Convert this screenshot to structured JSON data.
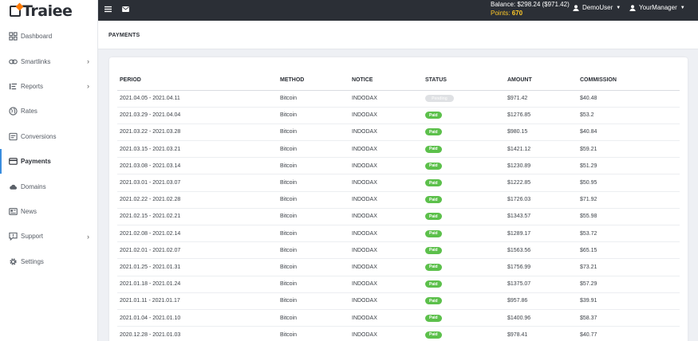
{
  "app": {
    "logo_text": "Traiee"
  },
  "sidebar": {
    "items": [
      {
        "label": "Dashboard",
        "icon": "dashboard-icon",
        "chevron": false,
        "active": false
      },
      {
        "label": "Smartlinks",
        "icon": "link-icon",
        "chevron": true,
        "active": false
      },
      {
        "label": "Reports",
        "icon": "reports-icon",
        "chevron": true,
        "active": false
      },
      {
        "label": "Rates",
        "icon": "globe-icon",
        "chevron": false,
        "active": false
      },
      {
        "label": "Conversions",
        "icon": "conversions-icon",
        "chevron": false,
        "active": false
      },
      {
        "label": "Payments",
        "icon": "credit-card-icon",
        "chevron": false,
        "active": true
      },
      {
        "label": "Domains",
        "icon": "cloud-icon",
        "chevron": false,
        "active": false
      },
      {
        "label": "News",
        "icon": "newspaper-icon",
        "chevron": false,
        "active": false
      },
      {
        "label": "Support",
        "icon": "support-icon",
        "chevron": true,
        "active": false
      },
      {
        "label": "Settings",
        "icon": "gear-icon",
        "chevron": false,
        "active": false
      }
    ]
  },
  "topbar": {
    "balance_label": "Balance: $298.24 ($971.42)",
    "points_label": "Points:",
    "points_value": "670",
    "user_label": "DemoUser",
    "manager_label": "YourManager"
  },
  "page": {
    "title": "PAYMENTS"
  },
  "table": {
    "headers": [
      "PERIOD",
      "METHOD",
      "NOTICE",
      "STATUS",
      "AMOUNT",
      "COMMISSION"
    ],
    "rows": [
      {
        "period": "2021.04.05 - 2021.04.11",
        "method": "Bitcoin",
        "notice": "INDODAX",
        "status": "Pending",
        "amount": "$971.42",
        "commission": "$40.48"
      },
      {
        "period": "2021.03.29 - 2021.04.04",
        "method": "Bitcoin",
        "notice": "INDODAX",
        "status": "Paid",
        "amount": "$1276.85",
        "commission": "$53.2"
      },
      {
        "period": "2021.03.22 - 2021.03.28",
        "method": "Bitcoin",
        "notice": "INDODAX",
        "status": "Paid",
        "amount": "$980.15",
        "commission": "$40.84"
      },
      {
        "period": "2021.03.15 - 2021.03.21",
        "method": "Bitcoin",
        "notice": "INDODAX",
        "status": "Paid",
        "amount": "$1421.12",
        "commission": "$59.21"
      },
      {
        "period": "2021.03.08 - 2021.03.14",
        "method": "Bitcoin",
        "notice": "INDODAX",
        "status": "Paid",
        "amount": "$1230.89",
        "commission": "$51.29"
      },
      {
        "period": "2021.03.01 - 2021.03.07",
        "method": "Bitcoin",
        "notice": "INDODAX",
        "status": "Paid",
        "amount": "$1222.85",
        "commission": "$50.95"
      },
      {
        "period": "2021.02.22 - 2021.02.28",
        "method": "Bitcoin",
        "notice": "INDODAX",
        "status": "Paid",
        "amount": "$1726.03",
        "commission": "$71.92"
      },
      {
        "period": "2021.02.15 - 2021.02.21",
        "method": "Bitcoin",
        "notice": "INDODAX",
        "status": "Paid",
        "amount": "$1343.57",
        "commission": "$55.98"
      },
      {
        "period": "2021.02.08 - 2021.02.14",
        "method": "Bitcoin",
        "notice": "INDODAX",
        "status": "Paid",
        "amount": "$1289.17",
        "commission": "$53.72"
      },
      {
        "period": "2021.02.01 - 2021.02.07",
        "method": "Bitcoin",
        "notice": "INDODAX",
        "status": "Paid",
        "amount": "$1563.56",
        "commission": "$65.15"
      },
      {
        "period": "2021.01.25 - 2021.01.31",
        "method": "Bitcoin",
        "notice": "INDODAX",
        "status": "Paid",
        "amount": "$1756.99",
        "commission": "$73.21"
      },
      {
        "period": "2021.01.18 - 2021.01.24",
        "method": "Bitcoin",
        "notice": "INDODAX",
        "status": "Paid",
        "amount": "$1375.07",
        "commission": "$57.29"
      },
      {
        "period": "2021.01.11 - 2021.01.17",
        "method": "Bitcoin",
        "notice": "INDODAX",
        "status": "Paid",
        "amount": "$957.86",
        "commission": "$39.91"
      },
      {
        "period": "2021.01.04 - 2021.01.10",
        "method": "Bitcoin",
        "notice": "INDODAX",
        "status": "Paid",
        "amount": "$1400.96",
        "commission": "$58.37"
      },
      {
        "period": "2020.12.28 - 2021.01.03",
        "method": "Bitcoin",
        "notice": "INDODAX",
        "status": "Paid",
        "amount": "$978.41",
        "commission": "$40.77"
      }
    ]
  },
  "colors": {
    "topbar_bg": "#2b2f36",
    "accent": "#3a8dde",
    "points": "#ffc928",
    "paid": "#5cc04b",
    "pending": "#dfe1e4"
  }
}
